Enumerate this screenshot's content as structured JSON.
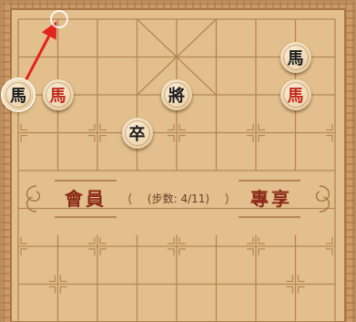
{
  "colors": {
    "board_bg": "#e2bf8c",
    "line": "#b58756",
    "frame": "#a87543",
    "river_text": "#8b2a1a",
    "red_piece_text": "#c2281c",
    "black_piece_text": "#1b1b1b",
    "move_arrow": "#e3241b"
  },
  "river": {
    "left_label": "會員",
    "right_label": "專享",
    "step_counter": "(步数: 4/11)"
  },
  "pieces": [
    {
      "id": "black-horse-top",
      "glyph": "馬",
      "side": "black",
      "col": 7,
      "row": 1
    },
    {
      "id": "black-horse-selected",
      "glyph": "馬",
      "side": "black",
      "col": 0,
      "row": 2,
      "selected": true
    },
    {
      "id": "red-horse-left",
      "glyph": "馬",
      "side": "red",
      "col": 1,
      "row": 2
    },
    {
      "id": "black-general",
      "glyph": "將",
      "side": "black",
      "col": 4,
      "row": 2
    },
    {
      "id": "red-horse-right",
      "glyph": "馬",
      "side": "red",
      "col": 7,
      "row": 2
    },
    {
      "id": "black-soldier",
      "glyph": "卒",
      "side": "black",
      "col": 3,
      "row": 3
    }
  ],
  "last_move": {
    "from": {
      "col": 0,
      "row": 2
    },
    "to": {
      "col": 1,
      "row": 0
    }
  }
}
